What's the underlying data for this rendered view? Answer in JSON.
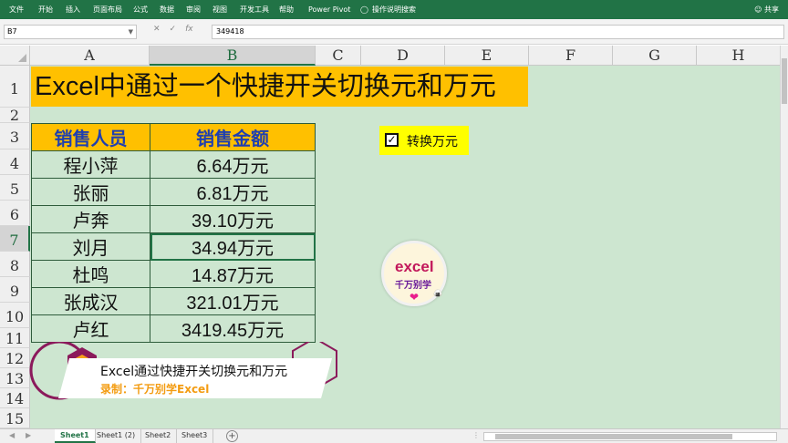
{
  "ribbon": {
    "tabs": [
      "文件",
      "开始",
      "插入",
      "页面布局",
      "公式",
      "数据",
      "审阅",
      "视图",
      "开发工具",
      "帮助",
      "Power Pivot",
      "操作说明搜索"
    ],
    "share_label": "共享",
    "color": "#217346"
  },
  "formula_bar": {
    "name_box": "B7",
    "formula": "349418"
  },
  "columns": [
    "A",
    "B",
    "C",
    "D",
    "E",
    "F",
    "G",
    "H"
  ],
  "rows": [
    "1",
    "2",
    "3",
    "4",
    "5",
    "6",
    "7",
    "8",
    "9",
    "10",
    "11",
    "12",
    "13",
    "14",
    "15"
  ],
  "selected_cell": {
    "column": "B",
    "row": "7"
  },
  "sheet": {
    "title": "Excel中通过一个快捷开关切换元和万元",
    "table": {
      "headers": [
        "销售人员",
        "销售金额"
      ],
      "rows": [
        [
          "程小萍",
          "6.64万元"
        ],
        [
          "张丽",
          "6.81万元"
        ],
        [
          "卢奔",
          "39.10万元"
        ],
        [
          "刘月",
          "34.94万元"
        ],
        [
          "杜鸣",
          "14.87万元"
        ],
        [
          "张成汉",
          "321.01万元"
        ],
        [
          "卢红",
          "3419.45万元"
        ]
      ]
    },
    "checkbox": {
      "label": "转换万元",
      "checked": true
    },
    "background_color": "#cde6d0",
    "header_fill": "#ffc000"
  },
  "watermark": {
    "line1": "excel",
    "line2": "千万别学",
    "line3": "🍙"
  },
  "overlay": {
    "line1": "Excel通过快捷开关切换元和万元",
    "line2": "录制：千万别学Excel"
  },
  "sheet_tabs": [
    "Sheet1",
    "Sheet1 (2)",
    "Sheet2",
    "Sheet3"
  ],
  "active_tab": "Sheet1"
}
